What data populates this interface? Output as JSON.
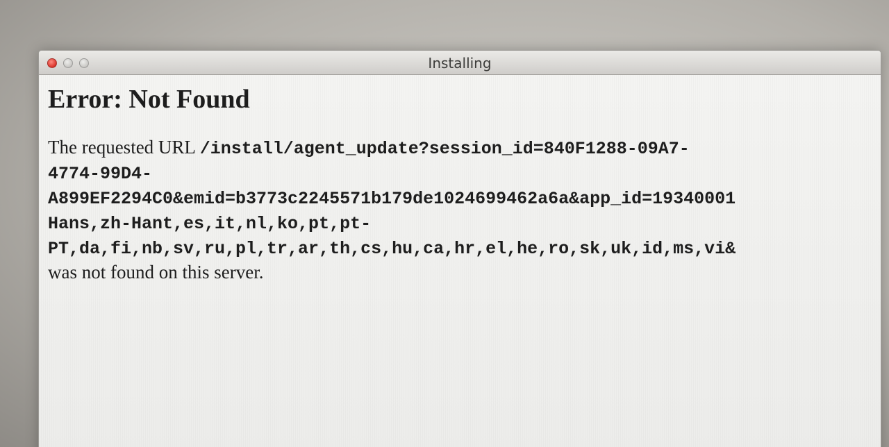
{
  "window": {
    "title": "Installing"
  },
  "page": {
    "heading": "Error: Not Found",
    "message_prefix": "The requested URL ",
    "url_lines": [
      "/install/agent_update?session_id=840F1288-09A7-",
      "4774-99D4-",
      "A899EF2294C0&emid=b3773c2245571b179de1024699462a6a&app_id=19340001",
      "Hans,zh-Hant,es,it,nl,ko,pt,pt-",
      "PT,da,fi,nb,sv,ru,pl,tr,ar,th,cs,hu,ca,hr,el,he,ro,sk,uk,id,ms,vi&"
    ],
    "message_suffix": "was not found on this server."
  },
  "colors": {
    "close_button": "#d9342b",
    "text": "#1d1d1d",
    "background": "#f1f1ef"
  },
  "icons": [
    "close-icon",
    "minimize-icon",
    "zoom-icon"
  ]
}
